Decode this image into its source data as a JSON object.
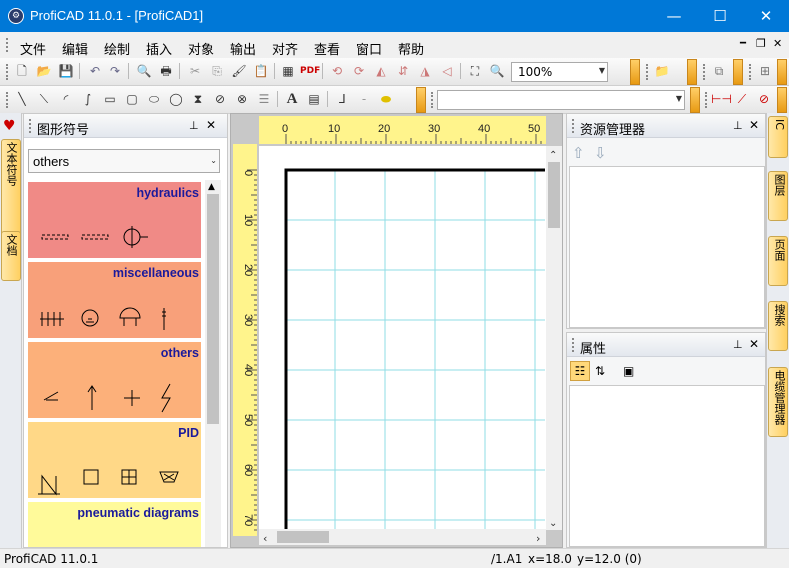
{
  "app": {
    "title": "ProfiCAD 11.0.1 - [ProfiCAD1]",
    "icon": "app-logo-icon"
  },
  "window": {
    "minimize": "—",
    "maximize": "☐",
    "close": "✕"
  },
  "menu": {
    "items": [
      "文件",
      "编辑",
      "绘制",
      "插入",
      "对象",
      "输出",
      "对齐",
      "查看",
      "窗口",
      "帮助"
    ],
    "mdi_min": "━",
    "mdi_restore": "❐",
    "mdi_close": "✕"
  },
  "toolbar": {
    "zoom": "100%",
    "pdf": "PDF",
    "text_tool": "A"
  },
  "left_tabs": [
    "文本符号",
    "文档"
  ],
  "symbols_panel": {
    "title": "图形符号",
    "pin": "📌",
    "close": "✕",
    "category_select": "others",
    "categories": [
      {
        "name": "hydraulics",
        "color": "#f08a86"
      },
      {
        "name": "miscellaneous",
        "color": "#f8a07a"
      },
      {
        "name": "others",
        "color": "#fcb07a"
      },
      {
        "name": "PID",
        "color": "#ffd887"
      },
      {
        "name": "pneumatic diagrams",
        "color": "#fffa9a"
      }
    ]
  },
  "ruler": {
    "top_labels": [
      "0",
      "10",
      "20",
      "30",
      "40",
      "50"
    ],
    "left_labels": [
      "0",
      "10",
      "20",
      "30",
      "40",
      "50",
      "60",
      "70"
    ]
  },
  "explorer_panel": {
    "title": "资源管理器",
    "pin": "📌",
    "close": "✕"
  },
  "properties_panel": {
    "title": "属性",
    "pin": "📌",
    "close": "✕"
  },
  "right_tabs": [
    "IC",
    "图层",
    "页面",
    "搜索",
    "电缆管理器"
  ],
  "status": {
    "app": "ProfiCAD 11.0.1",
    "sheet": "/1.A1",
    "x": "x=18.0",
    "y": "y=12.0 (0)"
  },
  "colors": {
    "titlebar": "#0078d7",
    "grid": "#8fdde6",
    "ruler": "#fff48c"
  }
}
